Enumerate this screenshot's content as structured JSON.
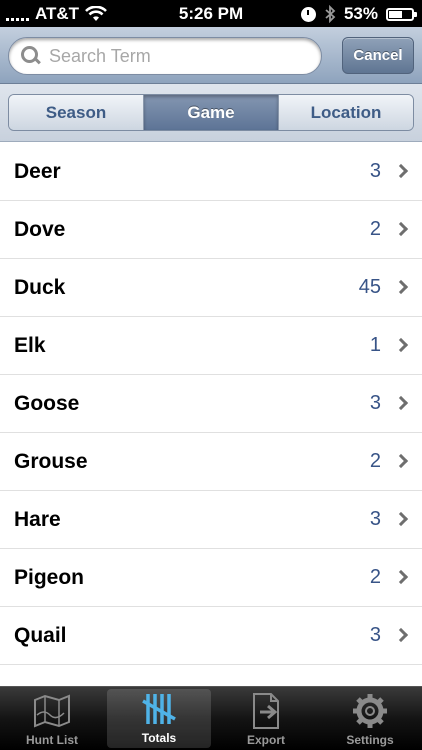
{
  "status_bar": {
    "carrier": "AT&T",
    "time": "5:26 PM",
    "battery": "53%",
    "battery_level": 0.53,
    "icons": [
      "signal-icon",
      "wifi-icon",
      "clock-icon",
      "bluetooth-icon",
      "battery-icon"
    ]
  },
  "search": {
    "placeholder": "Search Term",
    "value": "",
    "cancel_label": "Cancel"
  },
  "segments": {
    "items": [
      "Season",
      "Game",
      "Location"
    ],
    "selected": "Game"
  },
  "list": {
    "rows": [
      {
        "label": "Deer",
        "count": "3"
      },
      {
        "label": "Dove",
        "count": "2"
      },
      {
        "label": "Duck",
        "count": "45"
      },
      {
        "label": "Elk",
        "count": "1"
      },
      {
        "label": "Goose",
        "count": "3"
      },
      {
        "label": "Grouse",
        "count": "2"
      },
      {
        "label": "Hare",
        "count": "3"
      },
      {
        "label": "Pigeon",
        "count": "2"
      },
      {
        "label": "Quail",
        "count": "3"
      }
    ]
  },
  "tab_bar": {
    "tabs": [
      {
        "label": "Hunt List",
        "icon": "map-icon"
      },
      {
        "label": "Totals",
        "icon": "tally-icon"
      },
      {
        "label": "Export",
        "icon": "export-icon"
      },
      {
        "label": "Settings",
        "icon": "gear-icon"
      }
    ],
    "selected": "Totals"
  },
  "colors": {
    "count_text": "#385487",
    "segment_text": "#3e5c86",
    "tab_active_icon": "#4fb3e8"
  }
}
